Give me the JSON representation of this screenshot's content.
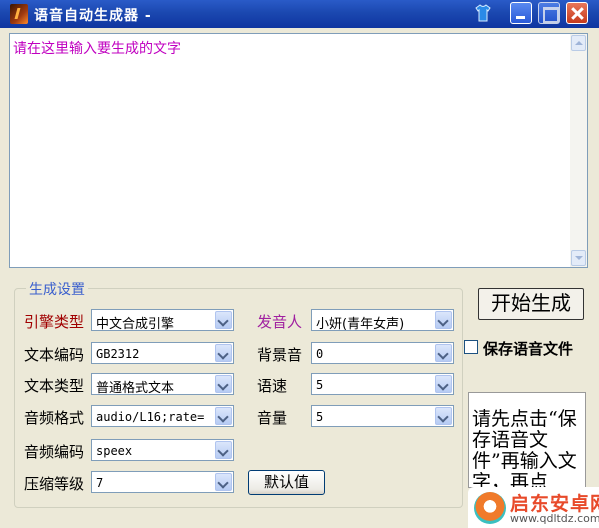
{
  "window": {
    "title": "语音自动生成器 -",
    "icons": [
      "app-icon",
      "skin-icon",
      "minimize-icon",
      "maximize-icon",
      "close-icon"
    ]
  },
  "editor": {
    "placeholder_text": "请在这里输入要生成的文字"
  },
  "settings": {
    "group_title": "生成设置",
    "engine_type": {
      "label": "引擎类型",
      "value": "中文合成引擎"
    },
    "text_encoding": {
      "label": "文本编码",
      "value": "GB2312"
    },
    "text_type": {
      "label": "文本类型",
      "value": "普通格式文本"
    },
    "audio_format": {
      "label": "音频格式",
      "value": "audio/L16;rate="
    },
    "audio_codec": {
      "label": "音频编码",
      "value": "speex"
    },
    "compression_level": {
      "label": "压缩等级",
      "value": "7"
    },
    "speaker": {
      "label": "发音人",
      "value": "小妍(青年女声)"
    },
    "background_sound": {
      "label": "背景音",
      "value": "0"
    },
    "speed": {
      "label": "语速",
      "value": "5"
    },
    "volume": {
      "label": "音量",
      "value": "5"
    },
    "default_button": "默认值"
  },
  "actions": {
    "start_button": "开始生成",
    "save_checkbox_label": "保存语音文件",
    "save_checkbox_checked": false,
    "hint_text": "请先点击“保存语音文件”再输入文字，再点击“开始"
  },
  "watermark": {
    "name": "启东安卓网",
    "url": "www.qdltdz.com"
  },
  "colors": {
    "titlebar": "#1b48b0",
    "placeholder": "#c000c0",
    "engine_label": "#a00000",
    "speaker_label": "#a020a0",
    "group_title": "#3a5fcd"
  }
}
